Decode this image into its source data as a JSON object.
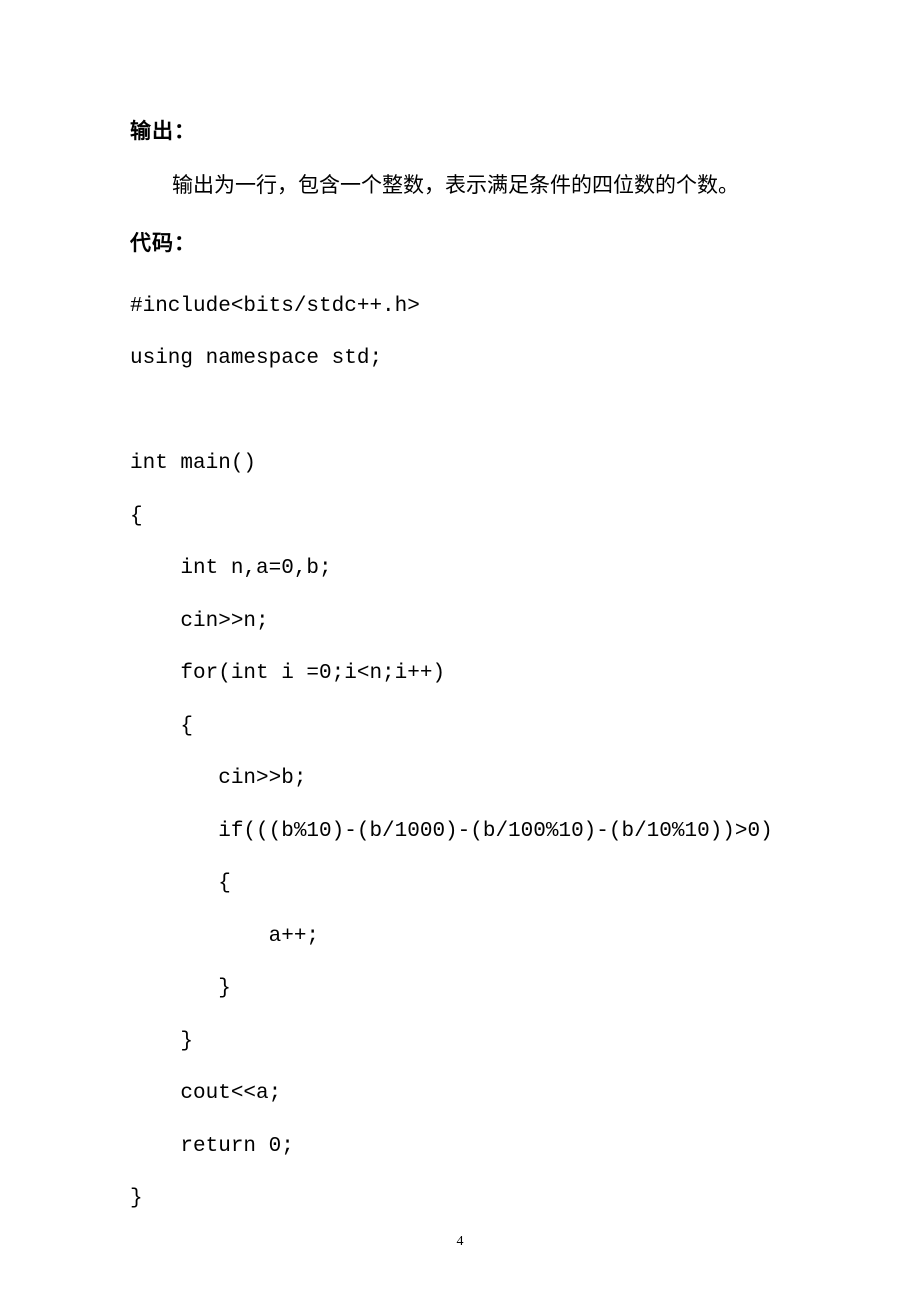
{
  "headings": {
    "output": "输出：",
    "code": "代码："
  },
  "body": {
    "output_desc": "输出为一行，包含一个整数，表示满足条件的四位数的个数。"
  },
  "code_lines": {
    "l1": "#include<bits/stdc++.h>",
    "l2": "using namespace std;",
    "l3": "",
    "l4": "int main()",
    "l5": "{",
    "l6": "    int n,a=0,b;",
    "l7": "    cin>>n;",
    "l8": "    for(int i =0;i<n;i++)",
    "l9": "    {",
    "l10": "       cin>>b;",
    "l11": "       if(((b%10)-(b/1000)-(b/100%10)-(b/10%10))>0)",
    "l12": "       {",
    "l13": "           a++;",
    "l14": "       }",
    "l15": "    }",
    "l16": "    cout<<a;",
    "l17": "    return 0;",
    "l18": "}"
  },
  "page_number": "4"
}
